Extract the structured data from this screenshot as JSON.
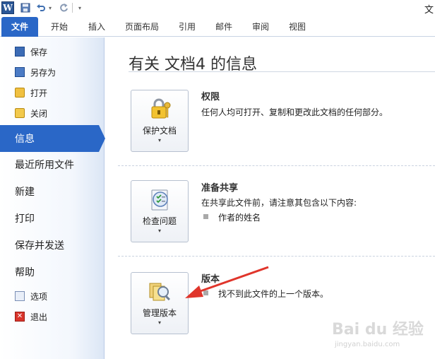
{
  "window": {
    "title_fragment": "文"
  },
  "quick_access": {
    "app_icon_letter": "W",
    "save_glyph": "💾",
    "undo_glyph": "↶",
    "redo_glyph": "↻",
    "dropdown_glyph": "▾"
  },
  "tabs": [
    {
      "label": "文件",
      "active": true
    },
    {
      "label": "开始"
    },
    {
      "label": "插入"
    },
    {
      "label": "页面布局"
    },
    {
      "label": "引用"
    },
    {
      "label": "邮件"
    },
    {
      "label": "审阅"
    },
    {
      "label": "视图"
    }
  ],
  "nav": {
    "small_top": [
      {
        "label": "保存",
        "icon": "save-icon"
      },
      {
        "label": "另存为",
        "icon": "save-as-icon"
      },
      {
        "label": "打开",
        "icon": "open-folder-icon"
      },
      {
        "label": "关闭",
        "icon": "close-folder-icon"
      }
    ],
    "big": [
      {
        "label": "信息",
        "active": true
      },
      {
        "label": "最近所用文件"
      },
      {
        "label": "新建"
      },
      {
        "label": "打印"
      },
      {
        "label": "保存并发送"
      },
      {
        "label": "帮助"
      }
    ],
    "small_bottom": [
      {
        "label": "选项",
        "icon": "options-icon"
      },
      {
        "label": "退出",
        "icon": "exit-icon",
        "glyph": "✕"
      }
    ]
  },
  "main": {
    "title": "有关 文档4 的信息",
    "sections": [
      {
        "button_label": "保护文档",
        "button_icon": "lock-keys-icon",
        "title": "权限",
        "description": "任何人均可打开、复制和更改此文档的任何部分。"
      },
      {
        "button_label": "检查问题",
        "button_icon": "checklist-icon",
        "title": "准备共享",
        "description": "在共享此文件前，请注意其包含以下内容:",
        "bullets": [
          "作者的姓名"
        ]
      },
      {
        "button_label": "管理版本",
        "button_icon": "versions-magnifier-icon",
        "title": "版本",
        "bullets": [
          "找不到此文件的上一个版本。"
        ]
      }
    ],
    "dropdown_glyph": "▾"
  },
  "annotation": {
    "color": "#e0352b"
  },
  "watermark": {
    "main": "Bai du 经验",
    "sub": "jingyan.baidu.com"
  },
  "colors": {
    "accent": "#2a67c7"
  }
}
